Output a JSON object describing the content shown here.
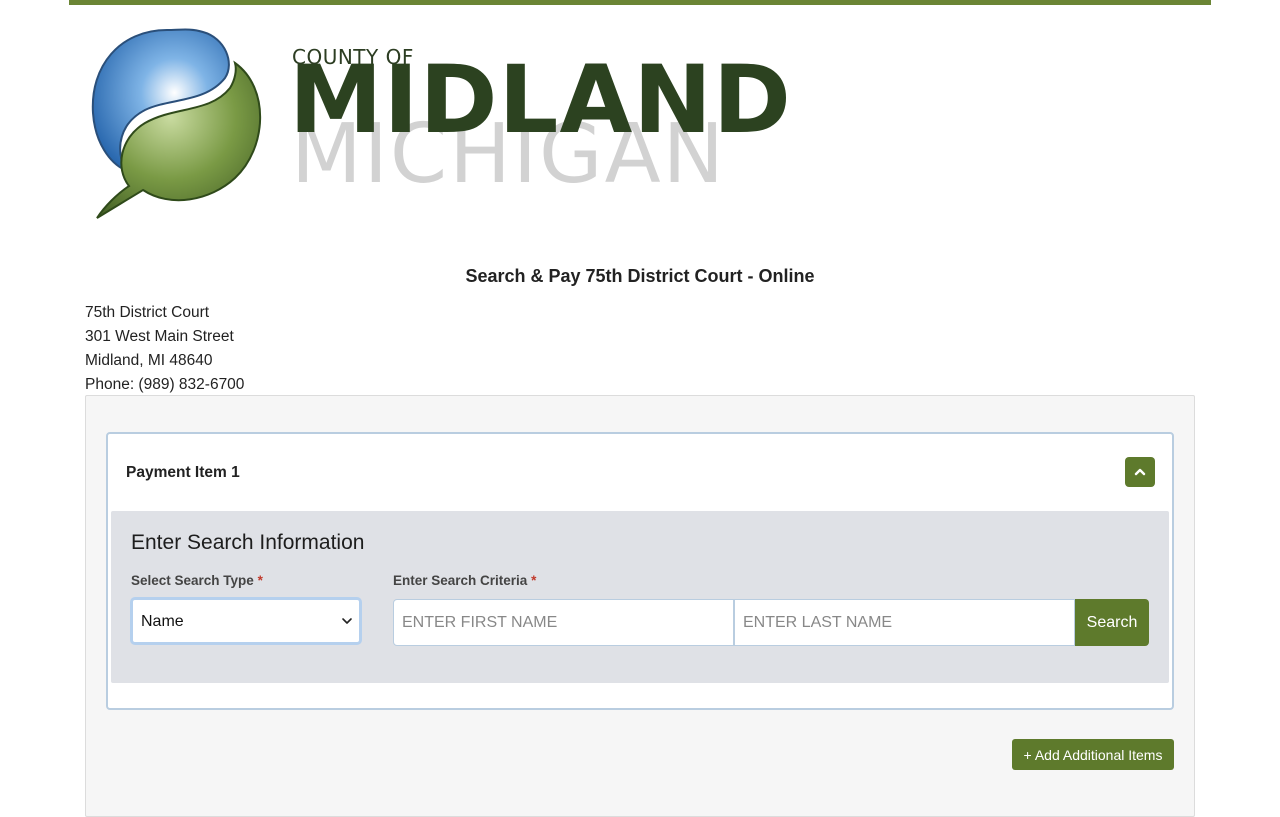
{
  "logo": {
    "line1": "COUNTY OF",
    "line2": "MIDLAND",
    "line3": "MICHIGAN"
  },
  "page": {
    "title": "Search & Pay 75th District Court - Online"
  },
  "address": {
    "name": "75th District Court",
    "street": "301 West Main Street",
    "city": "Midland, MI 48640",
    "phone": "Phone: (989) 832-6700"
  },
  "payment_item": {
    "title": "Payment Item 1",
    "collapse_icon": "chevron-up-icon",
    "search": {
      "heading": "Enter Search Information",
      "type_label": "Select Search Type",
      "criteria_label": "Enter Search Criteria",
      "required_mark": "*",
      "type_value": "Name",
      "first_name_placeholder": "ENTER FIRST NAME",
      "last_name_placeholder": "ENTER LAST NAME",
      "search_button": "Search"
    }
  },
  "actions": {
    "add_items": "+ Add Additional Items"
  },
  "colors": {
    "brand_green": "#5e7a2c",
    "top_bar": "#6b8535",
    "focus_border": "#b5d0ee"
  }
}
